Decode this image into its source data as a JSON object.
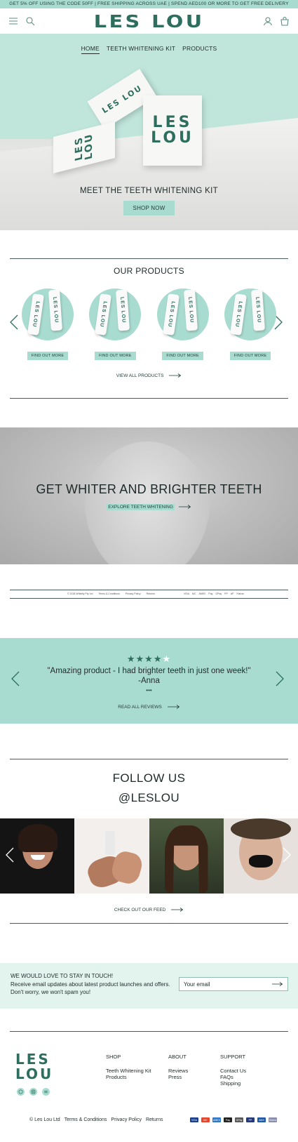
{
  "announcement": "GET 5% OFF USING THE CODE 50FF  |  FREE SHIPPING ACROSS UAE  |  SPEND AED100 OR MORE TO GET FREE DELIVERY",
  "header": {
    "logo": "LES LOU",
    "icons": [
      "menu-icon",
      "search-icon",
      "account-icon",
      "bag-icon"
    ]
  },
  "hero": {
    "nav": [
      "HOME",
      "TEETH WHITENING KIT",
      "PRODUCTS"
    ],
    "box_labels": [
      "LES LOU",
      "LES LOU",
      "LES LOU"
    ],
    "title": "MEET THE TEETH WHITENING KIT",
    "button": "SHOP NOW"
  },
  "products": {
    "title": "OUR PRODUCTS",
    "items": [
      {
        "bottle_label": "LES LOU",
        "button": "FIND OUT MORE"
      },
      {
        "bottle_label": "LES LOU",
        "button": "FIND OUT MORE"
      },
      {
        "bottle_label": "LES LOU",
        "button": "FIND OUT MORE"
      },
      {
        "bottle_label": "LES LOU",
        "button": "FIND OUT MORE"
      }
    ],
    "view_all": "VIEW ALL PRODUCTS"
  },
  "banner": {
    "title": "GET WHITER AND BRIGHTER TEETH",
    "link": "EXPLORE TEETH WHITENING"
  },
  "legal_strip": {
    "links": [
      "© 2018 Whitelly Pty Ltd",
      "Terms & Conditions",
      "Privacy Policy",
      "Returns"
    ],
    "payments": [
      "VISA",
      "MC",
      "AMEX",
      "Pay",
      "GPay",
      "PP",
      "AP",
      "Klarna"
    ]
  },
  "review": {
    "rating": 4,
    "max_rating": 5,
    "quote": "\"Amazing product - I had brighter teeth in just one week!\"",
    "author": "-Anna",
    "dots": "•••",
    "link": "READ ALL REVIEWS"
  },
  "follow": {
    "title": "FOLLOW US",
    "handle": "@LESLOU",
    "link": "CHECK OUT OUR FEED"
  },
  "newsletter": {
    "heading": "WE WOULD LOVE TO STAY IN TOUCH!",
    "body": "Receive email updates about latest product launches and offers. Don't worry, we won't spam you!",
    "placeholder": "Your email"
  },
  "footer": {
    "logo": "LES LOU",
    "shop": {
      "head": "SHOP",
      "items": [
        "Teeth Whitening Kit",
        "Products"
      ]
    },
    "about": {
      "head": "ABOUT",
      "items": [
        "Reviews",
        "Press"
      ]
    },
    "support": {
      "head": "SUPPORT",
      "items": [
        "Contact Us",
        "FAQs",
        "Shipping"
      ]
    },
    "copyright": "©  Les Lou Ltd",
    "bottom_links": [
      "Terms & Conditions",
      "Privacy Policy",
      "Returns"
    ],
    "payments": [
      "VISA",
      "MC",
      "AMEX",
      "Pay",
      "GPay",
      "PP",
      "AMX",
      "Klarna"
    ]
  },
  "colors": {
    "mint": "#a9dcd0",
    "brand_green": "#2d6e5e",
    "light_mint": "#e3f3ee"
  }
}
